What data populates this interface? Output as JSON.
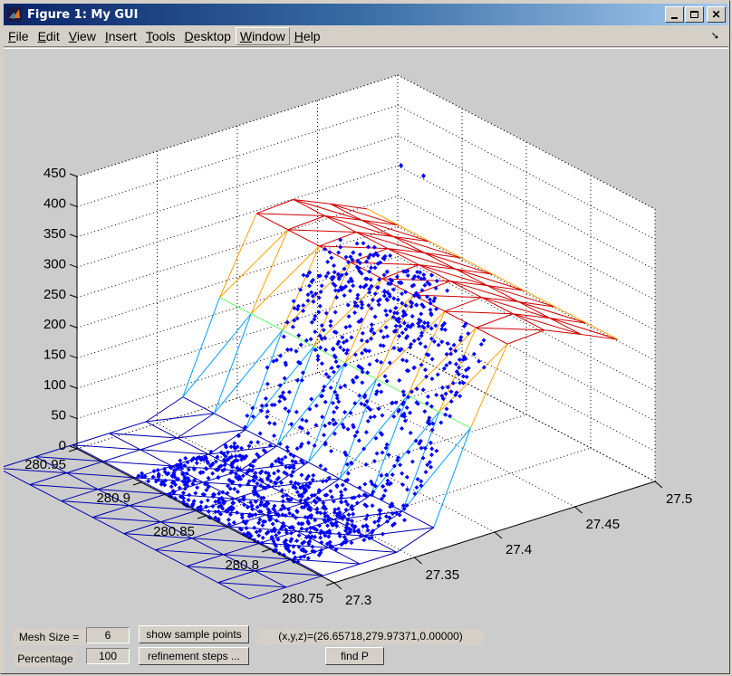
{
  "window": {
    "title": "Figure 1: My GUI",
    "icon": "matlab-logo-icon",
    "controls": [
      "minimize",
      "maximize",
      "close"
    ]
  },
  "menubar": {
    "items": [
      {
        "label": "File",
        "mnemonic": "F"
      },
      {
        "label": "Edit",
        "mnemonic": "E"
      },
      {
        "label": "View",
        "mnemonic": "V"
      },
      {
        "label": "Insert",
        "mnemonic": "I"
      },
      {
        "label": "Tools",
        "mnemonic": "T"
      },
      {
        "label": "Desktop",
        "mnemonic": "D"
      },
      {
        "label": "Window",
        "mnemonic": "W",
        "highlighted": true
      },
      {
        "label": "Help",
        "mnemonic": "H"
      }
    ],
    "undock_icon": "undock-arrow-icon"
  },
  "controls": {
    "mesh_size_label": "Mesh Size =",
    "mesh_size_value": "6",
    "percentage_label": "Percentage",
    "percentage_value": "100",
    "show_sample_points_button": "show sample points",
    "refinement_steps_button": "refinement steps ...",
    "coordinate_readout": "(x,y,z)=(26.65718,279.97371,0.00000)",
    "find_p_button": "find P"
  },
  "chart_data": {
    "type": "surface-mesh-scatter-3d",
    "title": "",
    "xlabel": "",
    "ylabel": "",
    "zlabel": "",
    "grid": true,
    "view": "3d-default",
    "x_ticks": [
      "27.3",
      "27.35",
      "27.4",
      "27.45",
      "27.5"
    ],
    "y_ticks": [
      "280.75",
      "280.8",
      "280.85",
      "280.9",
      "280.95"
    ],
    "z_ticks": [
      "0",
      "50",
      "100",
      "150",
      "200",
      "250",
      "300",
      "350",
      "400",
      "450"
    ],
    "xlim": [
      27.3,
      27.5
    ],
    "ylim": [
      280.75,
      280.95
    ],
    "zlim": [
      0,
      450
    ],
    "mesh": {
      "description": "triangular wireframe surface, colored by height (blue low -> green -> red high)",
      "x_range": [
        27.255,
        27.485
      ],
      "y_range": [
        280.76,
        280.955
      ],
      "low_plateau_z": 0,
      "high_plateau_z": 290,
      "transition_x": [
        27.36,
        27.42
      ],
      "colormap": [
        "#0000b0",
        "#00a0ff",
        "#60ff60",
        "#ffa000",
        "#d00000",
        "#800000"
      ]
    },
    "scatter": {
      "description": "sample points (blue diamonds) concentrated over the low plateau and ramp",
      "color": "#0000ff",
      "marker": "diamond",
      "region_x": [
        27.3,
        27.44
      ],
      "region_y": [
        280.78,
        280.91
      ],
      "outliers": [
        {
          "x": 27.47,
          "y": 280.91,
          "z": 370
        },
        {
          "x": 27.48,
          "y": 280.905,
          "z": 350
        }
      ]
    }
  }
}
